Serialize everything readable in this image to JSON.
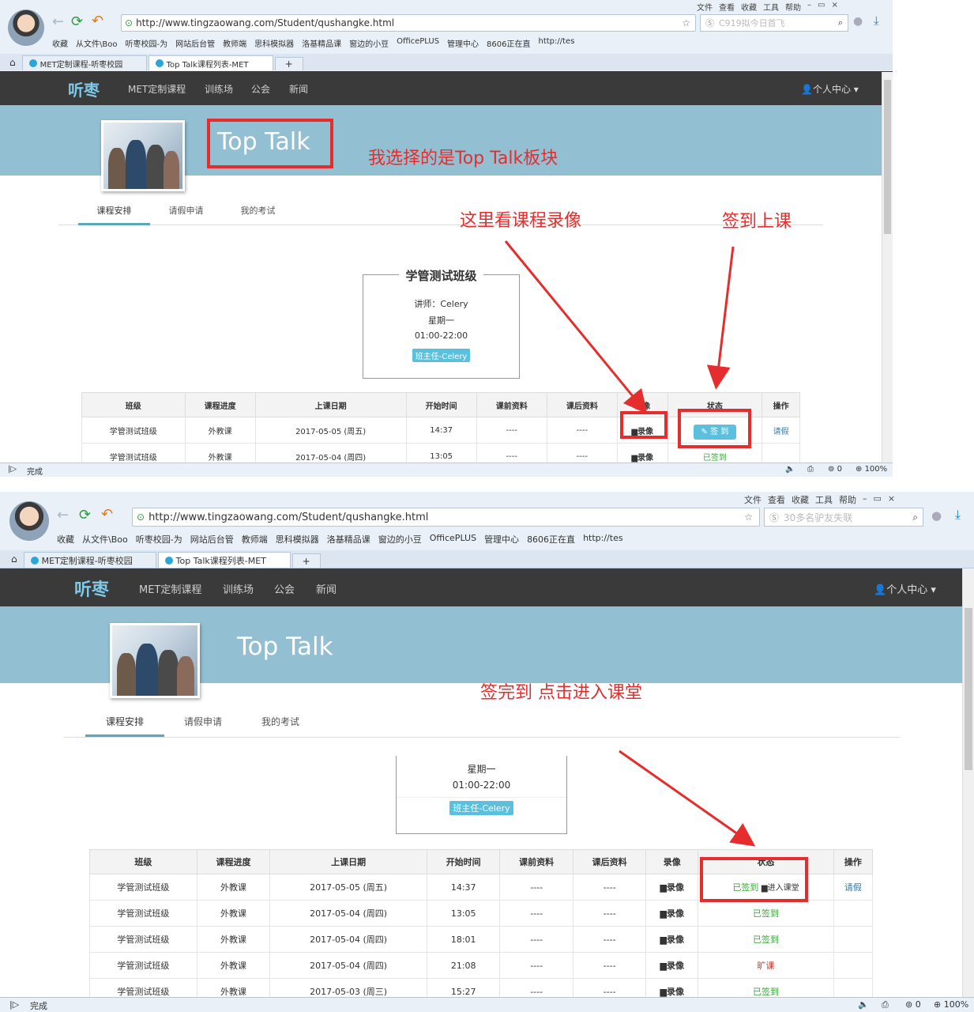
{
  "browser": {
    "url": "http://www.tingzaowang.com/Student/qushangke.html",
    "search1": "C919拟今日首飞",
    "search2": "30多名驴友失联",
    "menu": [
      "文件",
      "查看",
      "收藏",
      "工具",
      "帮助"
    ],
    "bookmarks": [
      "收藏",
      "从文件\\Boo",
      "听枣校园-为",
      "网站后台管",
      "教师端",
      "思科模拟器",
      "洛基精品课",
      "窗边的小豆",
      "OfficePLUS",
      "管理中心",
      "8606正在直",
      "http://tes"
    ],
    "tabs": [
      "MET定制课程-听枣校园",
      "Top Talk课程列表-MET"
    ],
    "tab_new": "+",
    "status_text": "完成",
    "status_count": "0",
    "zoom": "100%"
  },
  "site": {
    "logo": "听枣",
    "nav": [
      "MET定制课程",
      "训练场",
      "公会",
      "新闻"
    ],
    "user": "个人中心",
    "banner_title": "Top Talk",
    "subtabs": [
      "课程安排",
      "请假申请",
      "我的考试"
    ]
  },
  "card": {
    "class_name": "学管测试班级",
    "teacher": "讲师：Celery",
    "day": "星期一",
    "time": "01:00-22:00",
    "badge": "班主任-Celery"
  },
  "table": {
    "headers": [
      "班级",
      "课程进度",
      "上课日期",
      "开始时间",
      "课前资料",
      "课后资料",
      "录像",
      "状态",
      "操作"
    ],
    "rows1": [
      {
        "cls": "学管测试班级",
        "progress": "外教课",
        "date": "2017-05-05 (周五)",
        "start": "14:37",
        "pre": "----",
        "post": "----",
        "rec": "录像",
        "status": "签 到",
        "op": "请假"
      },
      {
        "cls": "学管测试班级",
        "progress": "外教课",
        "date": "2017-05-04 (周四)",
        "start": "13:05",
        "pre": "----",
        "post": "----",
        "rec": "录像",
        "status": "已签到",
        "op": ""
      }
    ],
    "rows2": [
      {
        "cls": "学管测试班级",
        "progress": "外教课",
        "date": "2017-05-05 (周五)",
        "start": "14:37",
        "pre": "----",
        "post": "----",
        "rec": "录像",
        "status": "已签到",
        "status2": "进入课堂",
        "op": "请假"
      },
      {
        "cls": "学管测试班级",
        "progress": "外教课",
        "date": "2017-05-04 (周四)",
        "start": "13:05",
        "pre": "----",
        "post": "----",
        "rec": "录像",
        "status": "已签到",
        "op": ""
      },
      {
        "cls": "学管测试班级",
        "progress": "外教课",
        "date": "2017-05-04 (周四)",
        "start": "18:01",
        "pre": "----",
        "post": "----",
        "rec": "录像",
        "status": "已签到",
        "op": ""
      },
      {
        "cls": "学管测试班级",
        "progress": "外教课",
        "date": "2017-05-04 (周四)",
        "start": "21:08",
        "pre": "----",
        "post": "----",
        "rec": "录像",
        "status": "旷课",
        "op": ""
      },
      {
        "cls": "学管测试班级",
        "progress": "外教课",
        "date": "2017-05-03 (周三)",
        "start": "15:27",
        "pre": "----",
        "post": "----",
        "rec": "录像",
        "status": "已签到",
        "op": ""
      }
    ]
  },
  "annotations": {
    "a1": "我选择的是Top Talk板块",
    "a2": "这里看课程录像",
    "a3": "签到上课",
    "a4": "签完到 点击进入课堂"
  },
  "colors": {
    "accent": "#5bc0de",
    "annotation": "#e52d2d",
    "banner": "#93bfd3",
    "nav": "#3a3a3a"
  }
}
